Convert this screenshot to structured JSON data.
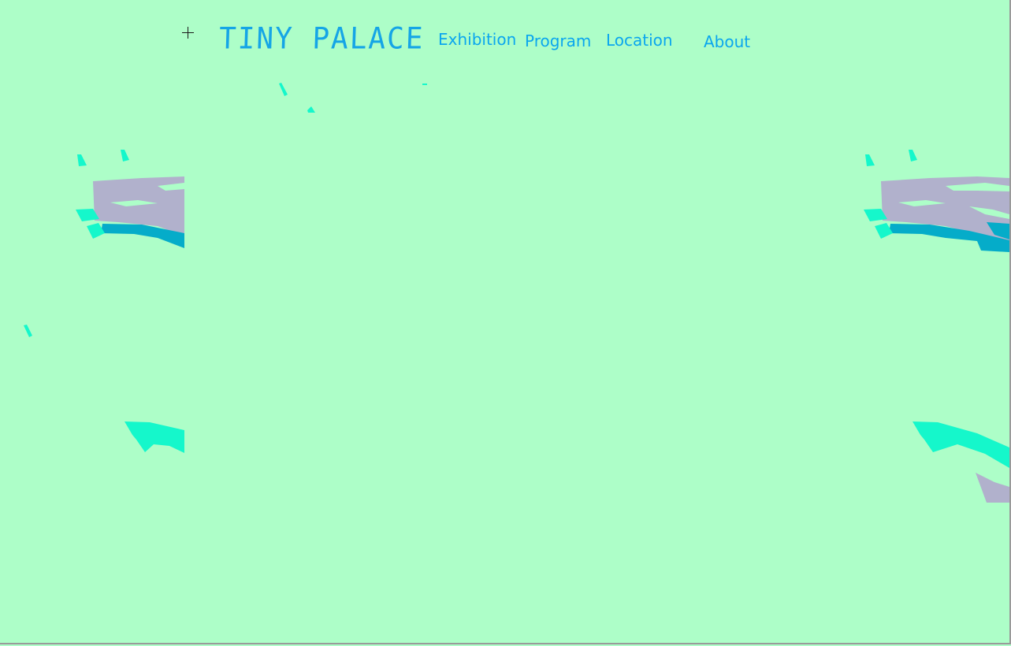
{
  "site": {
    "logo_text": "TINY PALACE"
  },
  "nav": {
    "items": [
      {
        "label": "Exhibition"
      },
      {
        "label": "Program"
      },
      {
        "label": "Location"
      },
      {
        "label": "About"
      }
    ]
  },
  "colors": {
    "background": "#adfec8",
    "accent": "#0aa6ee",
    "decor_mint": "#15f7cb",
    "decor_lavender": "#b1b1cc",
    "decor_teal": "#05acc9"
  },
  "icons": {
    "cursor": "crosshair-icon"
  }
}
